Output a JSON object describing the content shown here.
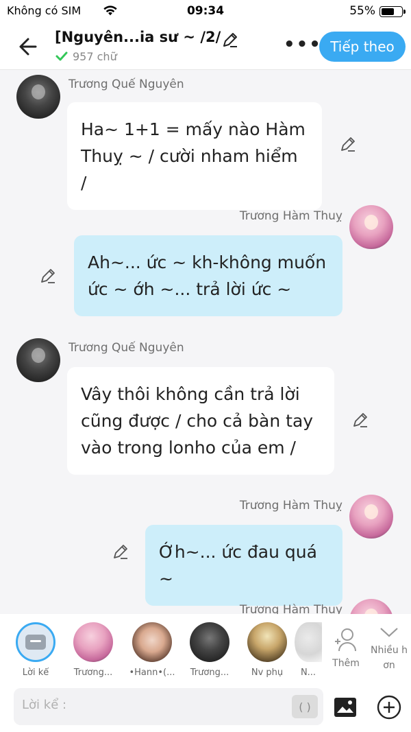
{
  "status_bar": {
    "carrier": "Không có SIM",
    "time": "09:34",
    "battery": "55%"
  },
  "header": {
    "title": "[Nguyên...ia sư ~ /2/",
    "word_count": "957 chữ",
    "next_label": "Tiếp theo"
  },
  "messages": [
    {
      "side": "left",
      "sender": "Trương Quế Nguyên",
      "text": "Ha~ 1+1 = mấy nào Hàm\nThuỵ ~ / cười nham hiểm /"
    },
    {
      "side": "right",
      "sender": "Trương Hàm Thuỵ",
      "text": "Ah~... ức ~ kh-không muốn\nức ~ ớh ~... trả lời ức ~"
    },
    {
      "side": "left",
      "sender": "Trương Quế Nguyên",
      "text": "Vây thôi không cần trả lời\ncũng được / cho cả bàn tay\nvào trong lonho của em /"
    },
    {
      "side": "right",
      "sender": "Trương Hàm Thuỵ",
      "text": "Ớh~... ức đau quá ~"
    },
    {
      "side": "right",
      "sender": "Trương Hàm Thuy",
      "text": ""
    }
  ],
  "characters": [
    {
      "name": "Lời kể"
    },
    {
      "name": "Trương..."
    },
    {
      "name": "•Hann•(..."
    },
    {
      "name": "Trương..."
    },
    {
      "name": "Nv phụ"
    },
    {
      "name": "N..."
    }
  ],
  "char_actions": {
    "add_label": "Thêm",
    "more_label_1": "Nhiều h",
    "more_label_2": "ơn"
  },
  "input": {
    "placeholder": "Lời kể :",
    "paren": "( )"
  },
  "colors": {
    "accent": "#3aaaf2",
    "right_bubble": "#cdeefa",
    "left_bubble": "#ffffff",
    "background": "#f5f5f7"
  }
}
